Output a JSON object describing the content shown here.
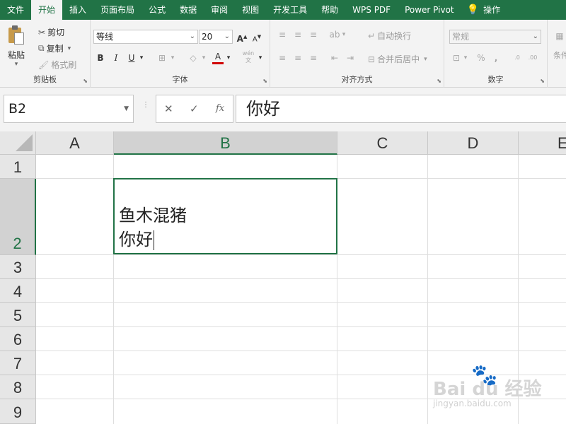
{
  "tabs": [
    "文件",
    "开始",
    "插入",
    "页面布局",
    "公式",
    "数据",
    "审阅",
    "视图",
    "开发工具",
    "帮助",
    "WPS PDF",
    "Power Pivot"
  ],
  "active_tab": "开始",
  "tell_me": "操作",
  "ribbon": {
    "clipboard": {
      "label": "剪贴板",
      "paste": "粘贴",
      "cut": "剪切",
      "copy": "复制",
      "format_painter": "格式刷"
    },
    "font": {
      "label": "字体",
      "font_name": "等线",
      "font_size": "20",
      "bold": "B",
      "italic": "I",
      "underline": "U",
      "font_color_letter": "A",
      "font_color": "#d00000",
      "phonetic": "wén"
    },
    "alignment": {
      "label": "对齐方式",
      "wrap_text": "自动换行",
      "merge_center": "合并后居中"
    },
    "number": {
      "label": "数字",
      "format": "常规",
      "percent": "%",
      "comma": ","
    },
    "more": "条件"
  },
  "formula_bar": {
    "name_box": "B2",
    "cancel": "✕",
    "enter": "✓",
    "fx": "fx",
    "content": "你好"
  },
  "grid": {
    "columns": [
      "A",
      "B",
      "C",
      "D",
      "E"
    ],
    "rows": [
      "1",
      "2",
      "3",
      "4",
      "5",
      "6",
      "7",
      "8",
      "9"
    ],
    "active_cell": "B2",
    "b2_line1": "鱼木混猪",
    "b2_line2": "你好"
  },
  "watermark": {
    "brand": "Bai du 经验",
    "url": "jingyan.baidu.com"
  },
  "colors": {
    "accent": "#217346",
    "ribbon_bg": "#f3f3f3",
    "header_bg": "#e6e6e6"
  }
}
